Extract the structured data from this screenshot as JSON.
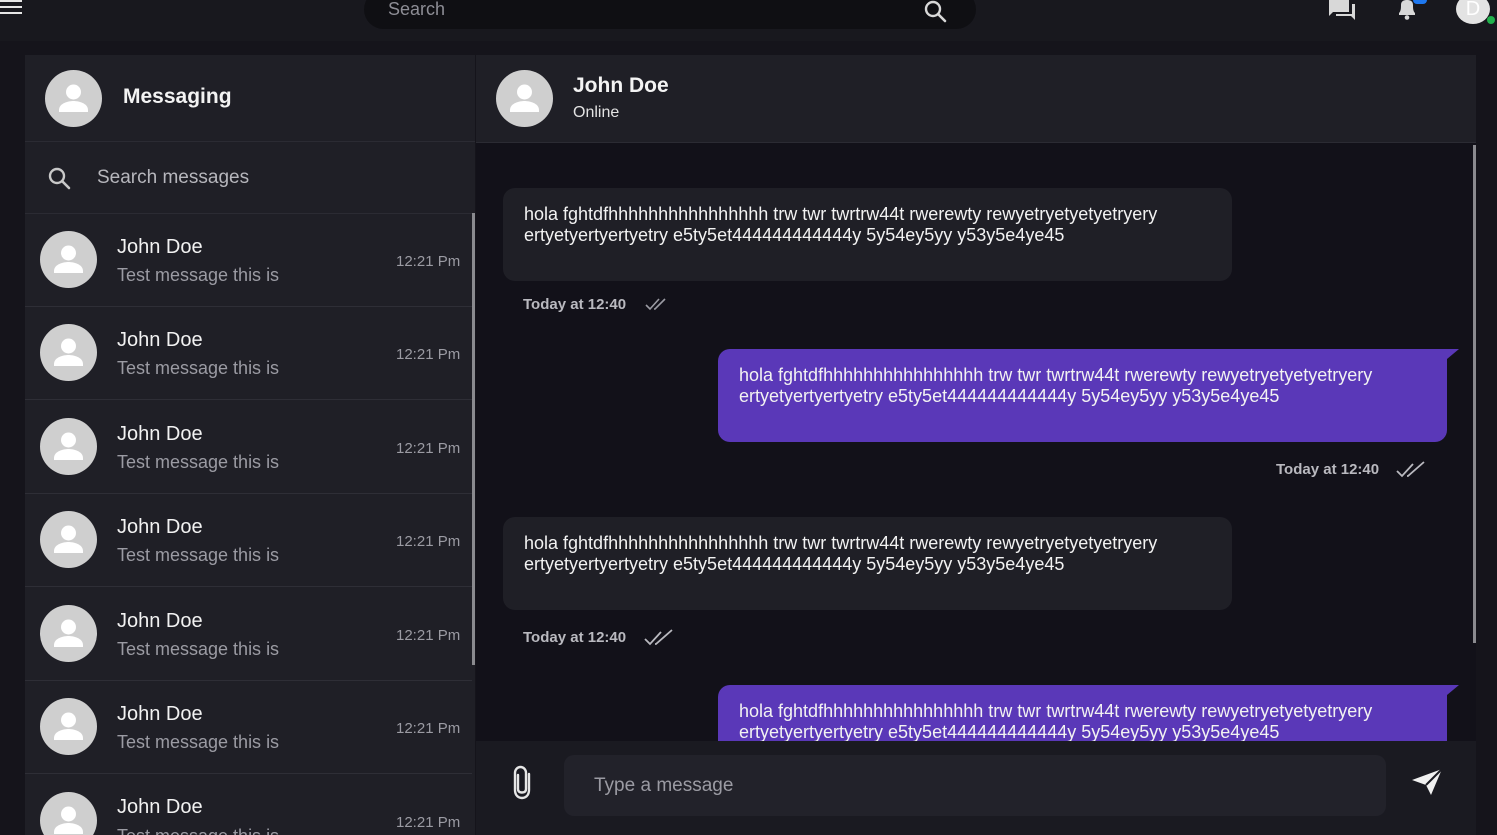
{
  "topbar": {
    "search_placeholder": "Search",
    "avatar_initial": "D",
    "icons": [
      "menu-icon",
      "search-icon",
      "chat-icon",
      "bell-icon"
    ]
  },
  "sidebar": {
    "title": "Messaging",
    "search_placeholder": "Search messages",
    "conversations": [
      {
        "name": "John Doe",
        "preview": "Test message this is",
        "time": "12:21 Pm"
      },
      {
        "name": "John Doe",
        "preview": "Test message this is",
        "time": "12:21 Pm"
      },
      {
        "name": "John Doe",
        "preview": "Test message this is",
        "time": "12:21 Pm"
      },
      {
        "name": "John Doe",
        "preview": "Test message this is",
        "time": "12:21 Pm"
      },
      {
        "name": "John Doe",
        "preview": "Test message this is",
        "time": "12:21 Pm"
      },
      {
        "name": "John Doe",
        "preview": "Test message this is",
        "time": "12:21 Pm"
      },
      {
        "name": "John Doe",
        "preview": "Test message this is",
        "time": "12:21 Pm"
      }
    ]
  },
  "chat": {
    "contact_name": "John Doe",
    "contact_status": "Online",
    "messages": [
      {
        "direction": "in",
        "text": "hola fghtdfhhhhhhhhhhhhhhhh trw twr twrtrw44t rwerewty rewyetryetyetyetryery ertyetyertyertyetry e5ty5et444444444444y 5y54ey5yy y53y5e4ye45",
        "time": "Today at 12:40"
      },
      {
        "direction": "out",
        "text": "hola fghtdfhhhhhhhhhhhhhhhh trw twr twrtrw44t rwerewty rewyetryetyetyetryery ertyetyertyertyetry e5ty5et444444444444y 5y54ey5yy y53y5e4ye45",
        "time": "Today at 12:40"
      },
      {
        "direction": "in",
        "text": "hola fghtdfhhhhhhhhhhhhhhhh trw twr twrtrw44t rwerewty rewyetryetyetyetryery ertyetyertyertyetry e5ty5et444444444444y 5y54ey5yy y53y5e4ye45",
        "time": "Today at 12:40"
      },
      {
        "direction": "out",
        "text": "hola fghtdfhhhhhhhhhhhhhhhh trw twr twrtrw44t rwerewty rewyetryetyetyetryery ertyetyertyertyetry e5ty5et444444444444y 5y54ey5yy y53y5e4ye45",
        "time": ""
      }
    ],
    "input_placeholder": "Type a message"
  },
  "colors": {
    "outgoing_bubble": "#5a38b8",
    "incoming_bubble": "#1f1f26",
    "online": "#22b14c",
    "notification": "#1e78f0"
  }
}
